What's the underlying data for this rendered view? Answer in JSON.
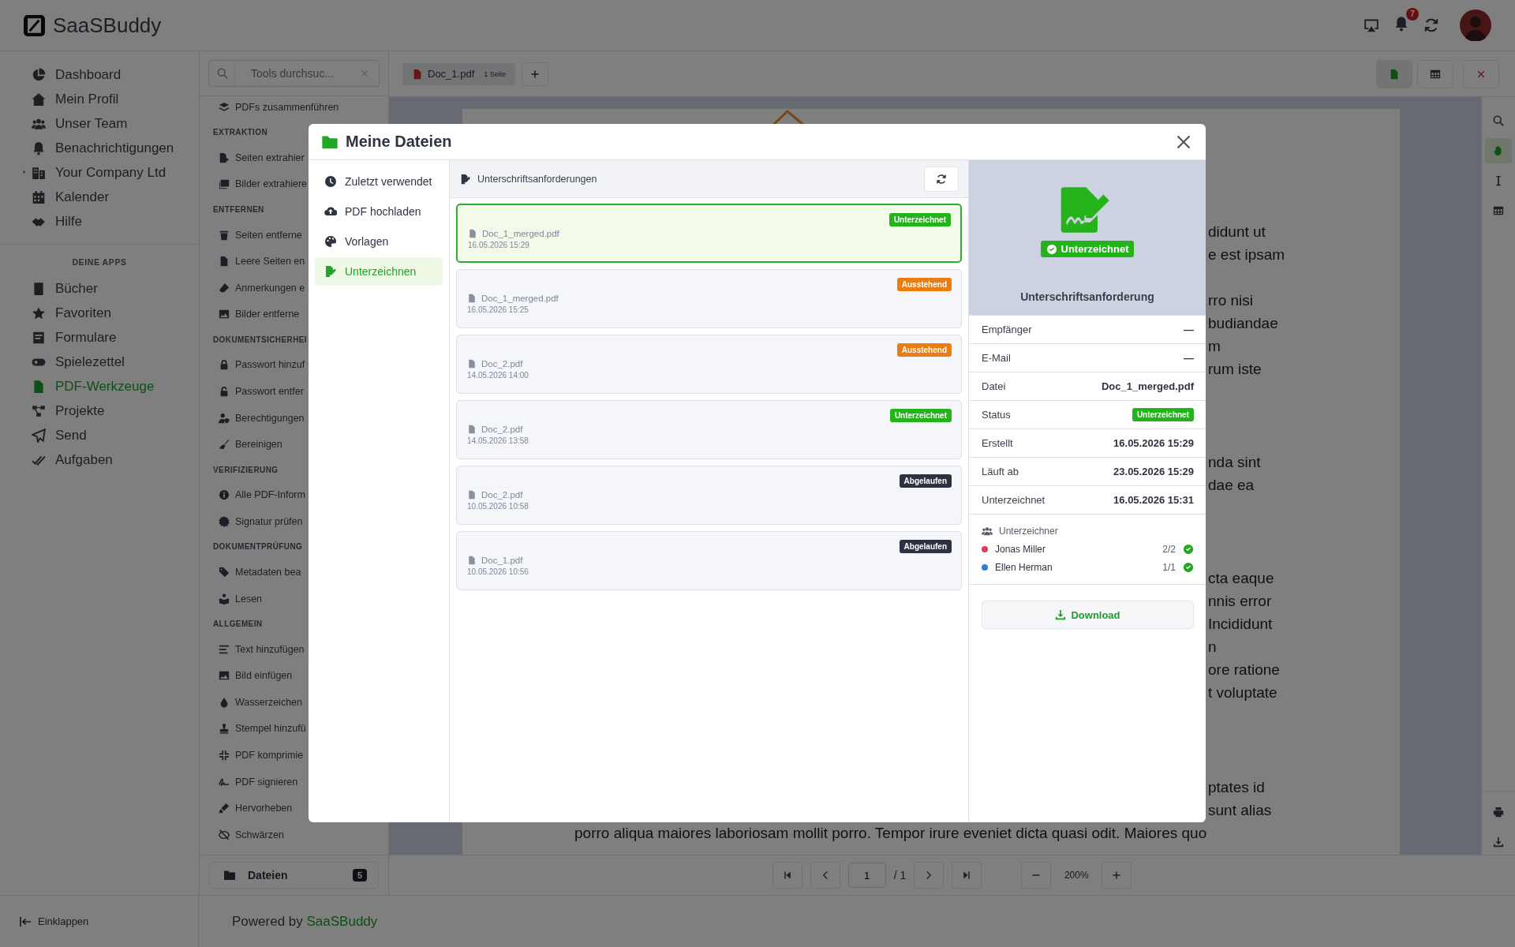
{
  "app": {
    "name": "SaaSBuddy"
  },
  "topbar": {
    "notification_count": "7"
  },
  "sidebar": {
    "items": [
      {
        "label": "Dashboard",
        "kind": "link",
        "selected": false
      },
      {
        "label": "Mein Profil",
        "kind": "link",
        "selected": false
      },
      {
        "label": "Unser Team",
        "kind": "link",
        "selected": false
      },
      {
        "label": "Benachrichtigungen",
        "kind": "link",
        "selected": false
      },
      {
        "label": "Your Company Ltd",
        "kind": "group",
        "expanded": false,
        "selected": false
      },
      {
        "label": "Kalender",
        "kind": "link",
        "selected": false
      },
      {
        "label": "Hilfe",
        "kind": "link",
        "selected": false
      }
    ],
    "apps_heading": "DEINE APPS",
    "apps": [
      {
        "label": "Bücher",
        "selected": false
      },
      {
        "label": "Favoriten",
        "selected": false
      },
      {
        "label": "Formulare",
        "selected": false
      },
      {
        "label": "Spielezettel",
        "selected": false
      },
      {
        "label": "PDF-Werkzeuge",
        "selected": true
      },
      {
        "label": "Projekte",
        "selected": false
      },
      {
        "label": "Send",
        "selected": false
      },
      {
        "label": "Aufgaben",
        "selected": false
      }
    ],
    "collapse": "Einklappen"
  },
  "tools": {
    "search_placeholder": "Tools durchsuc...",
    "items": [
      {
        "kind": "tool",
        "label": "PDFs zusammenführen"
      },
      {
        "kind": "heading",
        "label": "EXTRAKTION"
      },
      {
        "kind": "tool",
        "label": "Seiten extrahier"
      },
      {
        "kind": "tool",
        "label": "Bilder extrahiere"
      },
      {
        "kind": "heading",
        "label": "ENTFERNEN"
      },
      {
        "kind": "tool",
        "label": "Seiten entferne"
      },
      {
        "kind": "tool",
        "label": "Leere Seiten en"
      },
      {
        "kind": "tool",
        "label": "Anmerkungen e"
      },
      {
        "kind": "tool",
        "label": "Bilder entferne"
      },
      {
        "kind": "heading",
        "label": "DOKUMENTSICHERHEI"
      },
      {
        "kind": "tool",
        "label": "Passwort hinzuf"
      },
      {
        "kind": "tool",
        "label": "Passwort entfer"
      },
      {
        "kind": "tool",
        "label": "Berechtigungen"
      },
      {
        "kind": "tool",
        "label": "Bereinigen"
      },
      {
        "kind": "heading",
        "label": "VERIFIZIERUNG"
      },
      {
        "kind": "tool",
        "label": "Alle PDF-Inform"
      },
      {
        "kind": "tool",
        "label": "Signatur prüfen"
      },
      {
        "kind": "heading",
        "label": "DOKUMENTPRÜFUNG"
      },
      {
        "kind": "tool",
        "label": "Metadaten bea"
      },
      {
        "kind": "tool",
        "label": "Lesen"
      },
      {
        "kind": "heading",
        "label": "ALLGEMEIN"
      },
      {
        "kind": "tool",
        "label": "Text hinzufügen"
      },
      {
        "kind": "tool",
        "label": "Bild einfügen"
      },
      {
        "kind": "tool",
        "label": "Wasserzeichen"
      },
      {
        "kind": "tool",
        "label": "Stempel hinzufü"
      },
      {
        "kind": "tool",
        "label": "PDF komprimie"
      },
      {
        "kind": "tool",
        "label": "PDF signieren"
      },
      {
        "kind": "tool",
        "label": "Hervorheben"
      },
      {
        "kind": "tool",
        "label": "Schwärzen"
      }
    ],
    "files_button": {
      "label": "Dateien",
      "count": "5"
    }
  },
  "footer": {
    "text": "Powered by",
    "link": "SaaSBuddy"
  },
  "viewer": {
    "tabs": [
      {
        "label": "Doc_1.pdf",
        "pages": "1 Seite",
        "selected": true
      }
    ],
    "view_modes": [
      {
        "selected": true
      },
      {
        "selected": false
      }
    ],
    "side_tools": [
      {
        "selected": false
      },
      {
        "selected": true
      },
      {
        "selected": false
      },
      {
        "selected": false
      }
    ],
    "document": {
      "paragraphs": [
        [
          {
            "text": "didunt ut",
            "kind": "cut"
          },
          {
            "text": "e est ipsam",
            "kind": "cut"
          }
        ],
        [
          {
            "text": "rro nisi",
            "kind": "cut"
          },
          {
            "text": "budiandae",
            "kind": "cut"
          },
          {
            "text": "m",
            "kind": "cut"
          },
          {
            "text": "rum iste",
            "kind": "cut"
          }
        ],
        [
          {
            "text": "nda sint",
            "kind": "cut"
          },
          {
            "text": "dae ea",
            "kind": "cut"
          }
        ],
        [
          {
            "text": "cta eaque",
            "kind": "cut"
          },
          {
            "text": "nnis error",
            "kind": "cut"
          },
          {
            "text": "Incididunt",
            "kind": "cut"
          },
          {
            "text": "n",
            "kind": "cut"
          },
          {
            "text": "ore ratione",
            "kind": "cut"
          },
          {
            "text": "t voluptate",
            "kind": "cut"
          }
        ],
        [
          {
            "text": "ptates id",
            "kind": "cut"
          },
          {
            "text": "sunt alias",
            "kind": "cut"
          },
          {
            "text": "porro aliqua maiores laboriosam mollit porro. Tempor irure eveniet dicta quasi odit. Maiores quo",
            "kind": "whole"
          }
        ]
      ]
    },
    "pager": {
      "page": "1",
      "total": "/ 1",
      "zoom": "200%"
    }
  },
  "modal": {
    "title": "Meine Dateien",
    "nav": [
      {
        "label": "Zuletzt verwendet",
        "selected": false
      },
      {
        "label": "PDF hochladen",
        "selected": false
      },
      {
        "label": "Vorlagen",
        "selected": false
      },
      {
        "label": "Unterzeichnen",
        "selected": true
      }
    ],
    "list_title": "Unterschriftsanforderungen",
    "requests": [
      {
        "file": "Doc_1_merged.pdf",
        "date": "16.05.2026 15:29",
        "status": "Unterzeichnet",
        "kind": "signed",
        "selected": true
      },
      {
        "file": "Doc_1_merged.pdf",
        "date": "16.05.2026 15:25",
        "status": "Ausstehend",
        "kind": "pending",
        "selected": false
      },
      {
        "file": "Doc_2.pdf",
        "date": "14.05.2026 14:00",
        "status": "Ausstehend",
        "kind": "pending",
        "selected": false
      },
      {
        "file": "Doc_2.pdf",
        "date": "14.05.2026 13:58",
        "status": "Unterzeichnet",
        "kind": "signed",
        "selected": false
      },
      {
        "file": "Doc_2.pdf",
        "date": "10.05.2026 10:58",
        "status": "Abgelaufen",
        "kind": "expired",
        "selected": false
      },
      {
        "file": "Doc_1.pdf",
        "date": "10.05.2026 10:56",
        "status": "Abgelaufen",
        "kind": "expired",
        "selected": false
      }
    ],
    "detail": {
      "badge": {
        "label": "Unterzeichnet",
        "kind": "signed"
      },
      "title": "Unterschriftsanforderung",
      "fields": [
        {
          "label": "Empfänger",
          "value": "—",
          "kind": "text"
        },
        {
          "label": "E-Mail",
          "value": "—",
          "kind": "text"
        },
        {
          "label": "Datei",
          "value": "Doc_1_merged.pdf",
          "kind": "text"
        },
        {
          "label": "Status",
          "value": "Unterzeichnet",
          "kind": "signed"
        },
        {
          "label": "Erstellt",
          "value": "16.05.2026 15:29",
          "kind": "text"
        },
        {
          "label": "Läuft ab",
          "value": "23.05.2026 15:29",
          "kind": "text"
        },
        {
          "label": "Unterzeichnet",
          "value": "16.05.2026 15:31",
          "kind": "text"
        }
      ],
      "signers_title": "Unterzeichner",
      "signers": [
        {
          "name": "Jonas Miller",
          "progress": "2/2",
          "complete": true,
          "color": "#e0395a"
        },
        {
          "name": "Ellen Herman",
          "progress": "1/1",
          "complete": true,
          "color": "#2f7be0"
        }
      ],
      "download": "Download"
    }
  }
}
